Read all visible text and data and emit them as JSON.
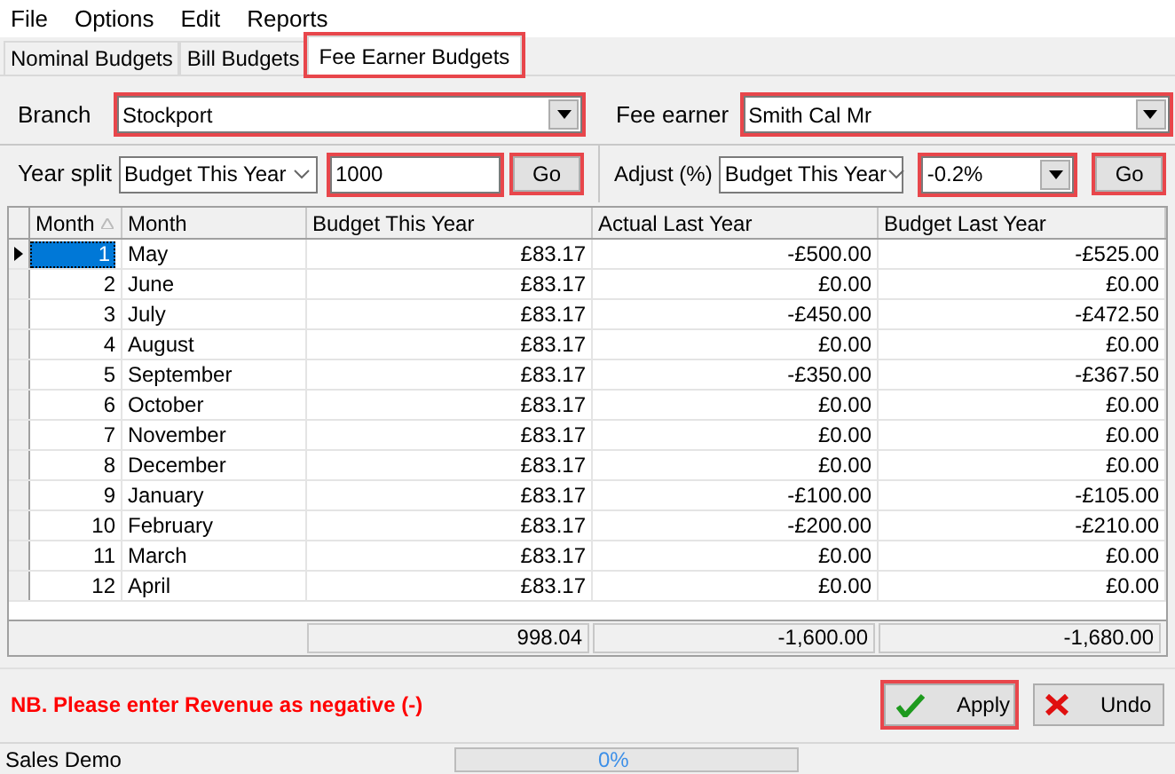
{
  "menu": [
    "File",
    "Options",
    "Edit",
    "Reports"
  ],
  "tabs": [
    {
      "label": "Nominal Budgets",
      "selected": false
    },
    {
      "label": "Bill Budgets",
      "selected": false
    },
    {
      "label": "Fee Earner Budgets",
      "selected": true,
      "highlighted": true
    }
  ],
  "branch": {
    "label": "Branch",
    "value": "Stockport",
    "highlighted": true
  },
  "fee_earner": {
    "label": "Fee earner",
    "value": "Smith Cal Mr",
    "highlighted": true
  },
  "year_split": {
    "label": "Year split",
    "source": "Budget This Year",
    "amount": "1000",
    "button": "Go",
    "highlighted": true
  },
  "adjust": {
    "label": "Adjust (%)",
    "source": "Budget This Year",
    "percent": "-0.2%",
    "button": "Go",
    "highlighted": true
  },
  "table": {
    "columns": [
      "Month",
      "Month",
      "Budget This Year",
      "Actual Last Year",
      "Budget Last Year"
    ],
    "rows": [
      {
        "cells": [
          "1",
          "May",
          "£83.17",
          "-£500.00",
          "-£525.00"
        ],
        "selected": true
      },
      {
        "cells": [
          "2",
          "June",
          "£83.17",
          "£0.00",
          "£0.00"
        ],
        "selected": false
      },
      {
        "cells": [
          "3",
          "July",
          "£83.17",
          "-£450.00",
          "-£472.50"
        ],
        "selected": false
      },
      {
        "cells": [
          "4",
          "August",
          "£83.17",
          "£0.00",
          "£0.00"
        ],
        "selected": false
      },
      {
        "cells": [
          "5",
          "September",
          "£83.17",
          "-£350.00",
          "-£367.50"
        ],
        "selected": false
      },
      {
        "cells": [
          "6",
          "October",
          "£83.17",
          "£0.00",
          "£0.00"
        ],
        "selected": false
      },
      {
        "cells": [
          "7",
          "November",
          "£83.17",
          "£0.00",
          "£0.00"
        ],
        "selected": false
      },
      {
        "cells": [
          "8",
          "December",
          "£83.17",
          "£0.00",
          "£0.00"
        ],
        "selected": false
      },
      {
        "cells": [
          "9",
          "January",
          "£83.17",
          "-£100.00",
          "-£105.00"
        ],
        "selected": false
      },
      {
        "cells": [
          "10",
          "February",
          "£83.17",
          "-£200.00",
          "-£210.00"
        ],
        "selected": false
      },
      {
        "cells": [
          "11",
          "March",
          "£83.17",
          "£0.00",
          "£0.00"
        ],
        "selected": false
      },
      {
        "cells": [
          "12",
          "April",
          "£83.17",
          "£0.00",
          "£0.00"
        ],
        "selected": false
      }
    ],
    "totals": [
      "998.04",
      "-1,600.00",
      "-1,680.00"
    ]
  },
  "note": "NB. Please enter Revenue as negative (-)",
  "buttons": [
    {
      "label": "Apply",
      "kind": "apply",
      "highlighted": true
    },
    {
      "label": "Undo",
      "kind": "undo",
      "highlighted": false
    }
  ],
  "status_bar": {
    "text": "Sales Demo",
    "progress": {
      "level": 0,
      "label": "0%"
    }
  }
}
